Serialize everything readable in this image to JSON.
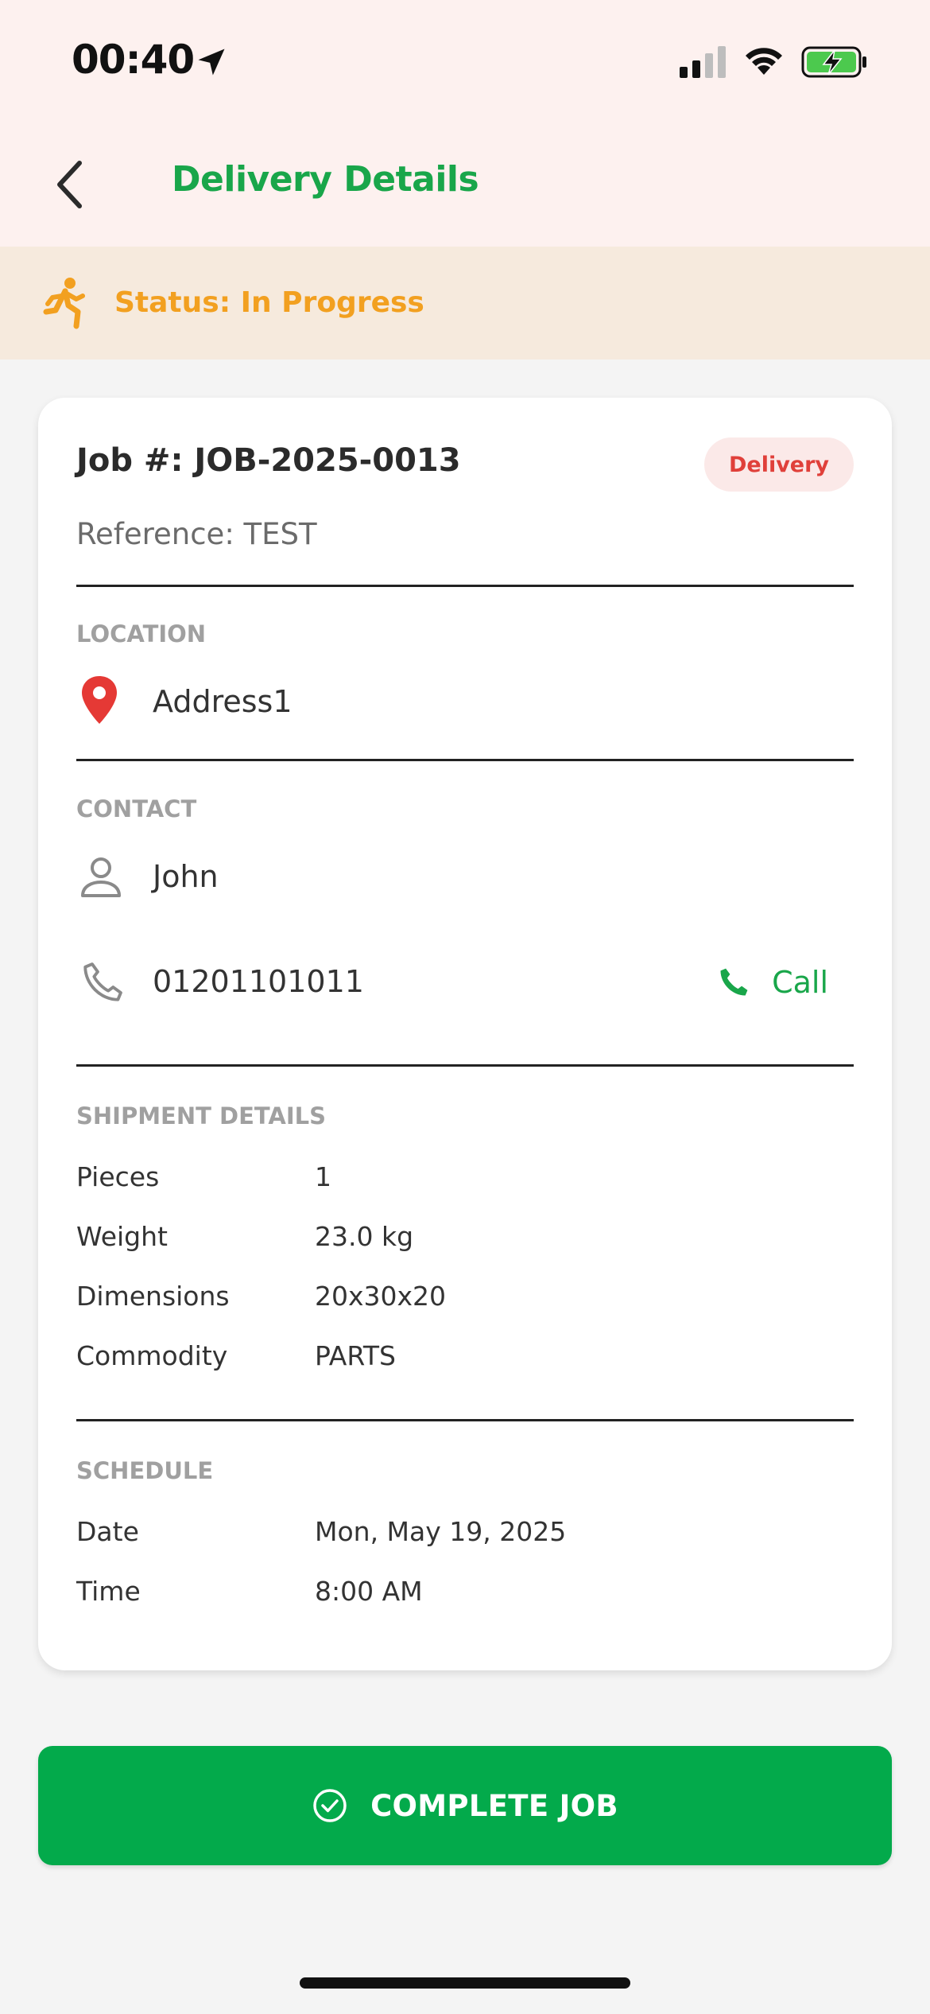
{
  "status_bar": {
    "time": "00:40",
    "icons": [
      "location-arrow-icon",
      "signal-icon",
      "wifi-icon",
      "battery-charging-icon"
    ]
  },
  "header": {
    "back_icon": "chevron-left-icon",
    "title": "Delivery Details"
  },
  "status_banner": {
    "icon": "running-person-icon",
    "text": "Status: In Progress"
  },
  "job": {
    "number": "Job #: JOB-2025-0013",
    "type_badge": "Delivery",
    "reference": "Reference: TEST"
  },
  "location": {
    "label": "LOCATION",
    "icon": "map-pin-icon",
    "address": "Address1"
  },
  "contact": {
    "label": "CONTACT",
    "name_icon": "person-icon",
    "name": "John",
    "phone_icon": "phone-icon",
    "phone": "01201101011",
    "call_label": "Call"
  },
  "shipment": {
    "label": "SHIPMENT DETAILS",
    "rows": [
      {
        "key": "Pieces",
        "value": "1"
      },
      {
        "key": "Weight",
        "value": "23.0 kg"
      },
      {
        "key": "Dimensions",
        "value": "20x30x20"
      },
      {
        "key": "Commodity",
        "value": "PARTS"
      }
    ]
  },
  "schedule": {
    "label": "SCHEDULE",
    "rows": [
      {
        "key": "Date",
        "value": "Mon, May 19, 2025"
      },
      {
        "key": "Time",
        "value": "8:00 AM"
      }
    ]
  },
  "action": {
    "complete_label": "COMPLETE JOB",
    "icon": "check-circle-icon"
  },
  "colors": {
    "accent_green": "#19a64a",
    "button_green": "#03aa4b",
    "status_orange": "#f2a020",
    "badge_red": "#e0403a",
    "header_bg": "#fdf1ef",
    "banner_bg": "#f6eadd"
  }
}
